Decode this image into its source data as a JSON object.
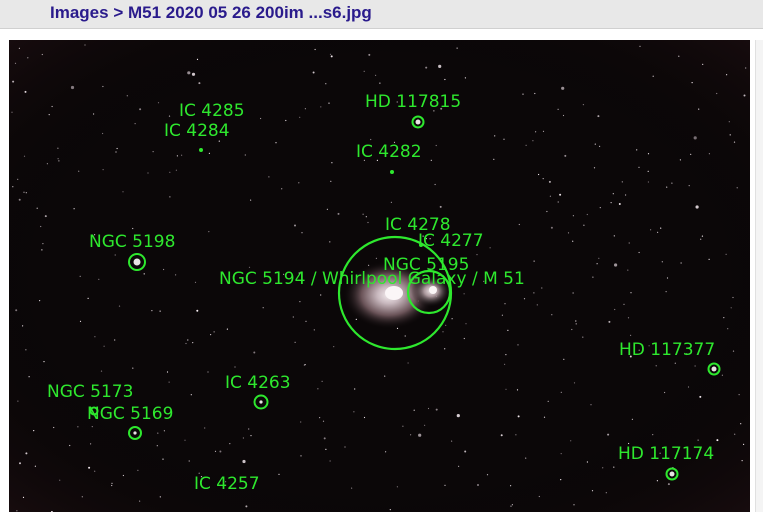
{
  "header": {
    "breadcrumb_link": "Images",
    "separator": ">",
    "file_title": "M51 2020 05 26 200im ...s6.jpg"
  },
  "annotation_color": "#2ee82e",
  "annotations": [
    {
      "id": "ic-4285",
      "label": "IC 4285"
    },
    {
      "id": "ic-4284",
      "label": "IC 4284"
    },
    {
      "id": "hd-117815",
      "label": "HD 117815"
    },
    {
      "id": "ic-4282",
      "label": "IC 4282"
    },
    {
      "id": "ic-4278",
      "label": "IC 4278"
    },
    {
      "id": "ic-4277",
      "label": "IC 4277"
    },
    {
      "id": "ngc-5198",
      "label": "NGC 5198"
    },
    {
      "id": "ngc-5195",
      "label": "NGC 5195"
    },
    {
      "id": "ngc-5194",
      "label": "NGC 5194 / Whirlpool Galaxy / M 51"
    },
    {
      "id": "hd-117377",
      "label": "HD 117377"
    },
    {
      "id": "ngc-5173",
      "label": "NGC 5173"
    },
    {
      "id": "ic-4263",
      "label": "IC 4263"
    },
    {
      "id": "ngc-5169",
      "label": "NGC 5169"
    },
    {
      "id": "hd-117174",
      "label": "HD 117174"
    },
    {
      "id": "ic-4257",
      "label": "IC 4257"
    }
  ]
}
